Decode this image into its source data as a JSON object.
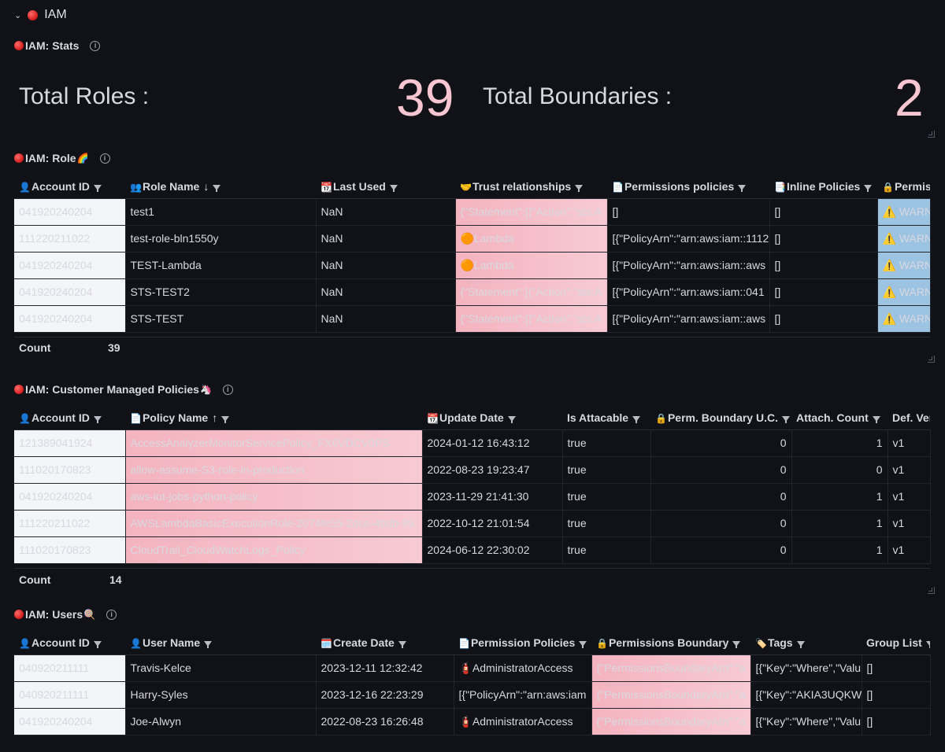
{
  "row": {
    "title": "IAM"
  },
  "stats": {
    "title": "IAM: Stats",
    "items": [
      {
        "label": "Total Roles :",
        "value": "39"
      },
      {
        "label": "Total Boundaries :",
        "value": "2"
      }
    ]
  },
  "roles": {
    "title": "IAM: Role",
    "title_emoji": "🌈",
    "columns": [
      {
        "icon": "👤",
        "label": "Account ID"
      },
      {
        "icon": "👥",
        "label": "Role Name",
        "sort": "↓"
      },
      {
        "icon": "📆",
        "label": "Last Used"
      },
      {
        "icon": "🤝",
        "label": "Trust relationships"
      },
      {
        "icon": "📄",
        "label": "Permissions policies"
      },
      {
        "icon": "📑",
        "label": "Inline Policies"
      },
      {
        "icon": "🔒",
        "label": "Permis"
      }
    ],
    "rows": [
      [
        "041920240204",
        "test1",
        "NaN",
        "{\"Statement\":[{\"Action\":\"sts:A",
        "[]",
        "[]",
        "⚠️ WARN"
      ],
      [
        "111220211022",
        "test-role-bln1550y",
        "NaN",
        "🟠Lambda",
        "[{\"PolicyArn\":\"arn:aws:iam::1112",
        "[]",
        "⚠️ WARN"
      ],
      [
        "041920240204",
        "TEST-Lambda",
        "NaN",
        "🟠Lambda",
        "[{\"PolicyArn\":\"arn:aws:iam::aws",
        "[]",
        "⚠️ WARN"
      ],
      [
        "041920240204",
        "STS-TEST2",
        "NaN",
        "{\"Statement\":[{\"Action\":\"sts:A",
        "[{\"PolicyArn\":\"arn:aws:iam::041",
        "[]",
        "⚠️ WARN"
      ],
      [
        "041920240204",
        "STS-TEST",
        "NaN",
        "{\"Statement\":[{\"Action\":\"sts:A",
        "[{\"PolicyArn\":\"arn:aws:iam::aws",
        "[]",
        "⚠️ WARN"
      ]
    ],
    "count_label": "Count",
    "count_value": "39"
  },
  "policies": {
    "title": "IAM: Customer Managed Policies",
    "title_emoji": "🦄",
    "columns": [
      {
        "icon": "👤",
        "label": "Account ID"
      },
      {
        "icon": "📄",
        "label": "Policy Name",
        "sort": "↑"
      },
      {
        "icon": "📆",
        "label": "Update Date"
      },
      {
        "icon": "",
        "label": "Is Attacable"
      },
      {
        "icon": "🔒",
        "label": "Perm. Boundary U.C."
      },
      {
        "icon": "",
        "label": "Attach. Count"
      },
      {
        "icon": "",
        "label": "Def. Ver"
      }
    ],
    "rows": [
      [
        "121389041924",
        "AccessAnalyzerMonitorServicePolicy_FX6VDCV0PS",
        "2024-01-12 16:43:12",
        "true",
        "0",
        "1",
        "v1"
      ],
      [
        "111020170823",
        "allow-assume-S3-role-in-production",
        "2022-08-23 19:23:47",
        "true",
        "0",
        "0",
        "v1"
      ],
      [
        "041920240204",
        "aws-iot-jobs-python-policy",
        "2023-11-29 21:41:30",
        "true",
        "0",
        "1",
        "v1"
      ],
      [
        "111220211022",
        "AWSLambdaBasicExecutionRole-2074fe55-2dce-4bdb-99",
        "2022-10-12 21:01:54",
        "true",
        "0",
        "1",
        "v1"
      ],
      [
        "111020170823",
        "CloudTrail_CloudWatchLogs_Policy",
        "2024-06-12 22:30:02",
        "true",
        "0",
        "1",
        "v1"
      ]
    ],
    "count_label": "Count",
    "count_value": "14"
  },
  "users": {
    "title": "IAM: Users",
    "title_emoji": "🍭",
    "columns": [
      {
        "icon": "👤",
        "label": "Account ID"
      },
      {
        "icon": "👤",
        "label": "User Name"
      },
      {
        "icon": "🗓️",
        "label": "Create Date"
      },
      {
        "icon": "📄",
        "label": "Permission Policies"
      },
      {
        "icon": "🔒",
        "label": "Permissions Boundary"
      },
      {
        "icon": "🏷️",
        "label": "Tags"
      },
      {
        "icon": "",
        "label": "Group List"
      }
    ],
    "rows": [
      [
        "040920211111",
        "Travis-Kelce",
        "2023-12-11 12:32:42",
        "🧯AdministratorAccess",
        "{\"PermissionsBoundaryArn\":\"a",
        "[{\"Key\":\"Where\",\"Valu",
        "[]"
      ],
      [
        "040920211111",
        "Harry-Syles",
        "2023-12-16 22:23:29",
        "[{\"PolicyArn\":\"arn:aws:iam",
        "{\"PermissionsBoundaryArn\":\"a",
        "[{\"Key\":\"AKIA3UQKW",
        "[]"
      ],
      [
        "041920240204",
        "Joe-Alwyn",
        "2022-08-23 16:26:48",
        "🧯AdministratorAccess",
        "{\"PermissionsBoundaryArn\":\"a",
        "[{\"Key\":\"Where\",\"Valu",
        "[]"
      ]
    ]
  },
  "colors": {
    "background": "#111217",
    "stat_value": "#f7c6d0",
    "pink_cell": "#f4b3bf",
    "blue_cell": "#9cc3e2",
    "account_cell": "#f4f5f8",
    "link": "#8ab8ff"
  }
}
